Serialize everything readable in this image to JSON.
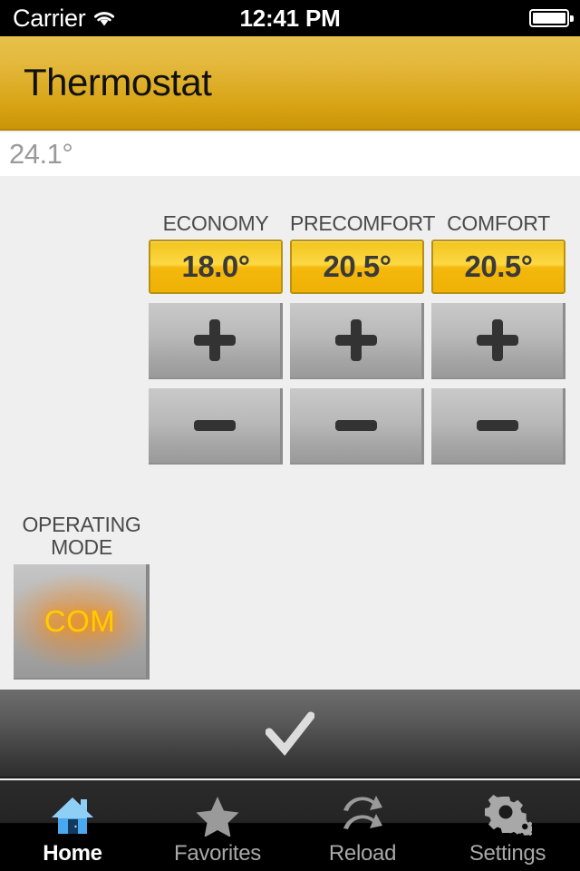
{
  "statusbar": {
    "carrier": "Carrier",
    "time": "12:41 PM",
    "wifi_icon": "wifi-icon",
    "battery_icon": "battery-icon"
  },
  "titlebar": {
    "title": "Thermostat"
  },
  "current": {
    "temperature": "24.1°"
  },
  "setpoints": [
    {
      "label": "ECONOMY",
      "value": "18.0°",
      "increase": "+",
      "decrease": "−"
    },
    {
      "label": "PRECOMFORT",
      "value": "20.5°",
      "increase": "+",
      "decrease": "−"
    },
    {
      "label": "COMFORT",
      "value": "20.5°",
      "increase": "+",
      "decrease": "−"
    }
  ],
  "operating_mode": {
    "label_line1": "OPERATING",
    "label_line2": "MODE",
    "value": "COM"
  },
  "confirm": {
    "icon": "checkmark-icon"
  },
  "tabbar": {
    "items": [
      {
        "label": "Home",
        "icon": "home-icon",
        "active": true
      },
      {
        "label": "Favorites",
        "icon": "star-icon",
        "active": false
      },
      {
        "label": "Reload",
        "icon": "refresh-icon",
        "active": false
      },
      {
        "label": "Settings",
        "icon": "gear-icon",
        "active": false
      }
    ]
  },
  "colors": {
    "accent_gold": "#e3b83c",
    "setpoint_yellow": "#f5c51a",
    "mode_text": "#ffcc00",
    "background": "#efefef",
    "tab_active": "#ffffff",
    "tab_inactive": "#a8a8a8"
  }
}
